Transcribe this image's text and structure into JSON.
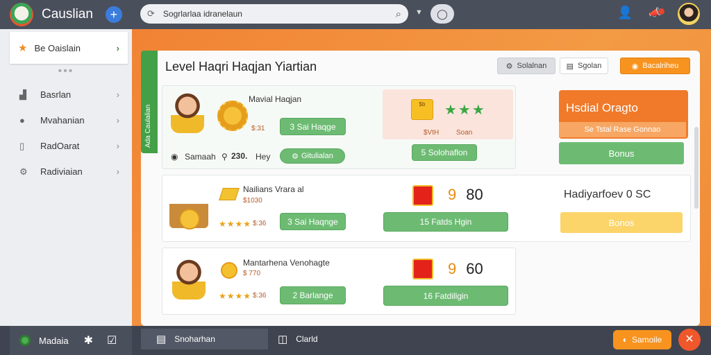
{
  "app": {
    "title": "Causlian"
  },
  "search": {
    "placeholder": "Sogrlarlaa idranelaun"
  },
  "sidebar": {
    "active": {
      "label": "Be Oaislain"
    },
    "items": [
      {
        "label": "Basrlan",
        "icon": "chart-icon"
      },
      {
        "label": "Mvahanian",
        "icon": "user-icon"
      },
      {
        "label": "RadOarat",
        "icon": "tablet-icon"
      },
      {
        "label": "Radiviaian",
        "icon": "settings-icon"
      }
    ]
  },
  "panel": {
    "title": "Level Haqri Haqjan Yiartian",
    "vertical_tab": "Ada Caulalian",
    "header_buttons": [
      "Solalnan",
      "Sgolan",
      "Bacalriheu"
    ]
  },
  "rows": [
    {
      "name": "Mavial Haqjan",
      "price": "$:31",
      "action": "3 Sai Haqge",
      "bottom_name": "Samaah",
      "bottom_value": "230.",
      "bottom_unit": "Hey",
      "bottom_action": "Gitulialan"
    },
    {
      "name": "Nailians Vrara al",
      "price": "$1030",
      "stars_price": "$:36",
      "action": "3 Sai Haqnge",
      "num": "9",
      "num2": "80",
      "wide_action": "15 Fatds Hgin"
    },
    {
      "name": "Mantarhena Venohagte",
      "price": "$ 770",
      "stars_price": "$:36",
      "action": "2 Barlange",
      "num": "9",
      "num2": "60",
      "wide_action": "16 Fatdillgin"
    }
  ],
  "reward": {
    "ticket_label": "$b",
    "caption_left": "$VtH",
    "caption_right": "Soan",
    "action": "5 Solohaflon"
  },
  "right": {
    "orange_title": "Hsdial Oragto",
    "orange_strip": "Se Tstal Rase Gonnao",
    "bonus_green": "Bonus",
    "row2_title": "Hadiyarfoev 0 SC",
    "bonus_yellow": "Bonos"
  },
  "bottom": {
    "left_label": "Madaia",
    "tab1": "Snoharhan",
    "tab2": "Clarld",
    "button": "Samoile"
  }
}
